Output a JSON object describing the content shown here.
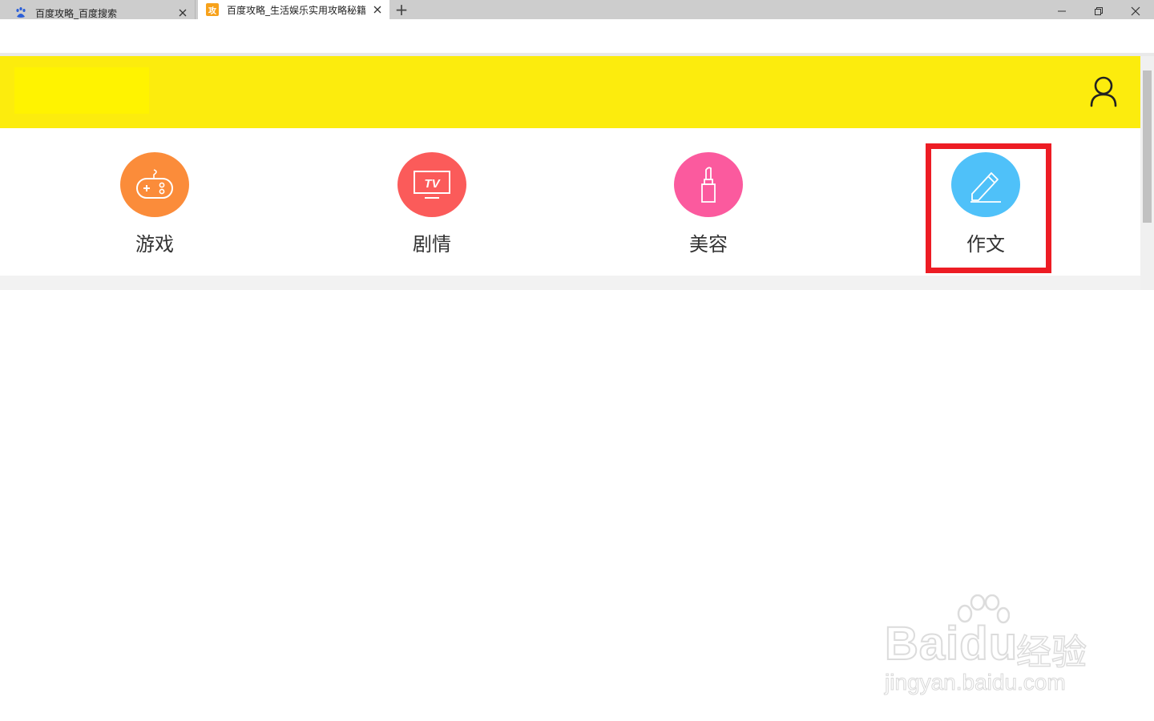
{
  "browser": {
    "tabs": [
      {
        "title": "百度攻略_百度搜索",
        "favicon": "baidu-paw-icon",
        "active": false
      },
      {
        "title": "百度攻略_生活娱乐实用攻略秘籍",
        "favicon_text": "攻",
        "active": true
      }
    ],
    "new_tab_symbol": "+",
    "window_controls": [
      "minimize-icon",
      "restore-icon",
      "close-icon"
    ]
  },
  "site": {
    "header_color": "#fcec0d",
    "user_icon": "user-icon",
    "nav": [
      {
        "label": "游戏",
        "icon": "gamepad-icon",
        "color": "#fb8c3a"
      },
      {
        "label": "剧情",
        "icon": "tv-icon",
        "color": "#fb5b5a"
      },
      {
        "label": "美容",
        "icon": "lipstick-icon",
        "color": "#fb5a9e"
      },
      {
        "label": "作文",
        "icon": "pencil-icon",
        "color": "#4fc1f9"
      }
    ],
    "highlight_color": "#ed1c24"
  },
  "watermark": {
    "brand": "Bai",
    "brand_tail": "du",
    "brand_cn": "经验",
    "url": "jingyan.baidu.com"
  }
}
